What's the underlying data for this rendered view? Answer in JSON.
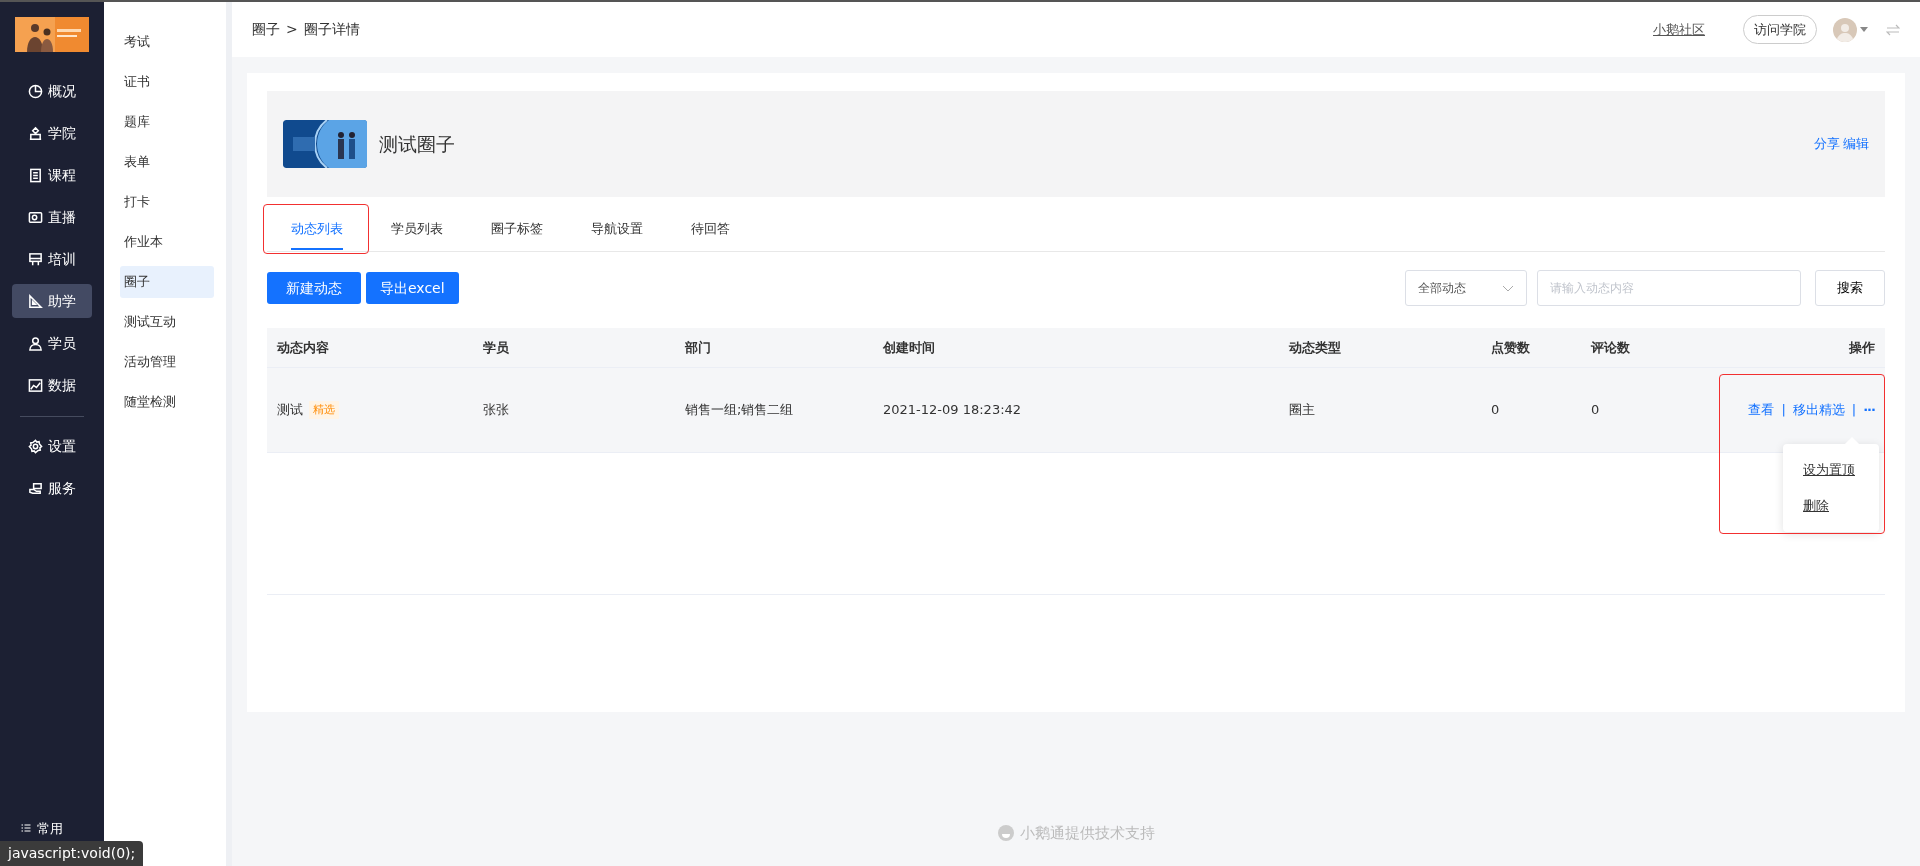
{
  "sidebar": {
    "logo": {
      "kind": "picture"
    },
    "items": [
      {
        "label": "概况",
        "selected": false
      },
      {
        "label": "学院",
        "selected": false
      },
      {
        "label": "课程",
        "selected": false
      },
      {
        "label": "直播",
        "selected": false
      },
      {
        "label": "培训",
        "selected": false
      },
      {
        "label": "助学",
        "selected": true
      },
      {
        "label": "学员",
        "selected": false
      },
      {
        "label": "数据",
        "selected": false
      }
    ],
    "bottom_items": [
      {
        "label": "设置",
        "selected": false
      },
      {
        "label": "服务",
        "selected": false
      }
    ],
    "footer_item": {
      "label": "常用"
    }
  },
  "subnav": {
    "items": [
      {
        "label": "考试",
        "selected": false
      },
      {
        "label": "证书",
        "selected": false
      },
      {
        "label": "题库",
        "selected": false
      },
      {
        "label": "表单",
        "selected": false
      },
      {
        "label": "打卡",
        "selected": false
      },
      {
        "label": "作业本",
        "selected": false
      },
      {
        "label": "圈子",
        "selected": true
      },
      {
        "label": "测试互动",
        "selected": false
      },
      {
        "label": "活动管理",
        "selected": false
      },
      {
        "label": "随堂检测",
        "selected": false
      }
    ]
  },
  "header": {
    "breadcrumb": [
      "圈子",
      ">",
      "圈子详情"
    ],
    "community_link": "小鹅社区",
    "visit_button": "访问学院"
  },
  "circle": {
    "cover": {
      "kind": "picture"
    },
    "title": "测试圈子",
    "actions": [
      "分享",
      "编辑"
    ]
  },
  "tabs": [
    {
      "label": "动态列表",
      "selected": true,
      "annotated": true
    },
    {
      "label": "学员列表",
      "selected": false,
      "annotated": false
    },
    {
      "label": "圈子标签",
      "selected": false,
      "annotated": false
    },
    {
      "label": "导航设置",
      "selected": false,
      "annotated": false
    },
    {
      "label": "待回答",
      "selected": false,
      "annotated": false
    }
  ],
  "toolbar": {
    "buttons": [
      "新建动态",
      "导出excel"
    ],
    "filter": "全部动态",
    "search": {
      "placeholder": "请输入动态内容"
    },
    "search_button": "搜索"
  },
  "table": {
    "columns": [
      "动态内容",
      "学员",
      "部门",
      "创建时间",
      "动态类型",
      "点赞数",
      "评论数",
      "操作"
    ],
    "rows": [
      {
        "content": "测试",
        "tag": "精选",
        "student": "张张",
        "department": "销售一组;销售二组",
        "created": "2021-12-09 18:23:42",
        "type": "圈主",
        "likes": "0",
        "comments": "0",
        "actions": [
          "查看",
          "移出精选"
        ],
        "separator": "|",
        "more": "···",
        "annotated": true,
        "menu_open": true,
        "menu": [
          "设为置顶",
          "删除"
        ]
      }
    ]
  },
  "footer": "小鹅通提供技术支持",
  "status_tooltip": "javascript:void(0);"
}
